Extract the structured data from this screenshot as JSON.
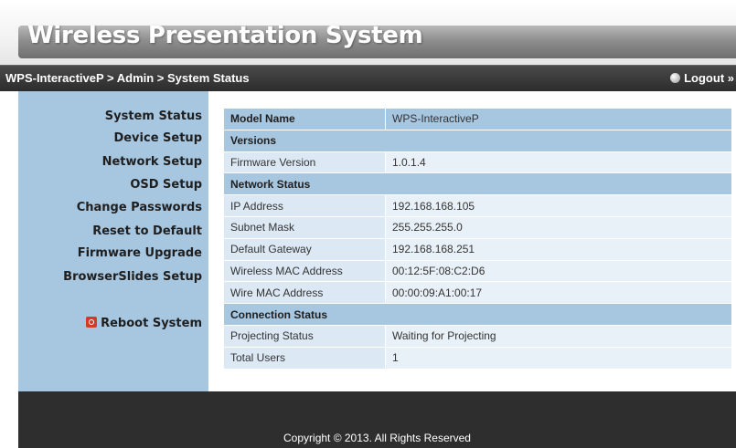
{
  "header": {
    "title": "Wireless Presentation System"
  },
  "topbar": {
    "breadcrumb": "WPS-InteractiveP > Admin > System Status",
    "logout_label": "Logout »"
  },
  "sidebar": {
    "items": [
      {
        "label": "System Status"
      },
      {
        "label": "Device Setup"
      },
      {
        "label": "Network Setup"
      },
      {
        "label": "OSD Setup"
      },
      {
        "label": "Change Passwords"
      },
      {
        "label": "Reset to Default"
      },
      {
        "label": "Firmware Upgrade"
      },
      {
        "label": "BrowserSlides Setup"
      }
    ],
    "reboot_label": "Reboot System"
  },
  "status": {
    "model_name_label": "Model Name",
    "model_name_value": "WPS-InteractiveP",
    "versions_header": "Versions",
    "firmware_label": "Firmware Version",
    "firmware_value": "1.0.1.4",
    "network_header": "Network Status",
    "ip_label": "IP Address",
    "ip_value": "192.168.168.105",
    "subnet_label": "Subnet Mask",
    "subnet_value": "255.255.255.0",
    "gateway_label": "Default Gateway",
    "gateway_value": "192.168.168.251",
    "wireless_mac_label": "Wireless MAC Address",
    "wireless_mac_value": "00:12:5F:08:C2:D6",
    "wire_mac_label": "Wire MAC Address",
    "wire_mac_value": "00:00:09:A1:00:17",
    "connection_header": "Connection Status",
    "projecting_label": "Projecting Status",
    "projecting_value": "Waiting for Projecting",
    "users_label": "Total Users",
    "users_value": "1"
  },
  "footer": {
    "copyright": "Copyright © 2013. All Rights Reserved"
  },
  "colors": {
    "sidebar_bg": "#a7c6e0",
    "row_bg": "#dce9f4",
    "bar_bg": "#2c2c2c"
  },
  "icons": {
    "logout": "logout-icon",
    "reboot": "power-icon"
  }
}
